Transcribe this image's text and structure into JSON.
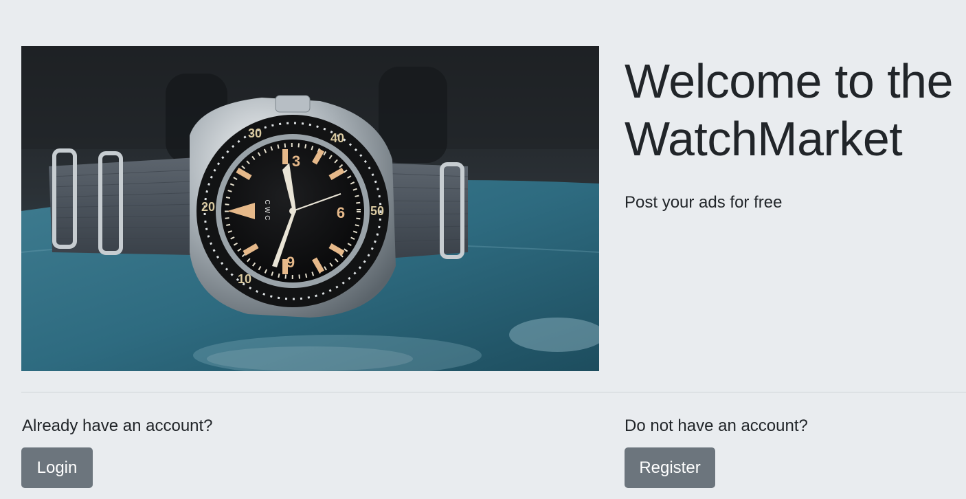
{
  "hero": {
    "title": "Welcome to the WatchMarket",
    "tagline": "Post your ads for free",
    "image": {
      "subject": "diver wrist watch on grey nylon strap",
      "dial_text": "CWC",
      "bezel_numbers": [
        "30",
        "40",
        "50",
        "20",
        "10"
      ],
      "dial_numbers": [
        "3",
        "6",
        "9"
      ]
    }
  },
  "login_section": {
    "prompt": "Already have an account?",
    "button_label": "Login"
  },
  "register_section": {
    "prompt": "Do not have an account?",
    "button_label": "Register"
  },
  "colors": {
    "page_background": "#e9ecef",
    "button_background": "#6c757d",
    "button_text": "#ffffff",
    "divider": "#cfd3d7"
  }
}
